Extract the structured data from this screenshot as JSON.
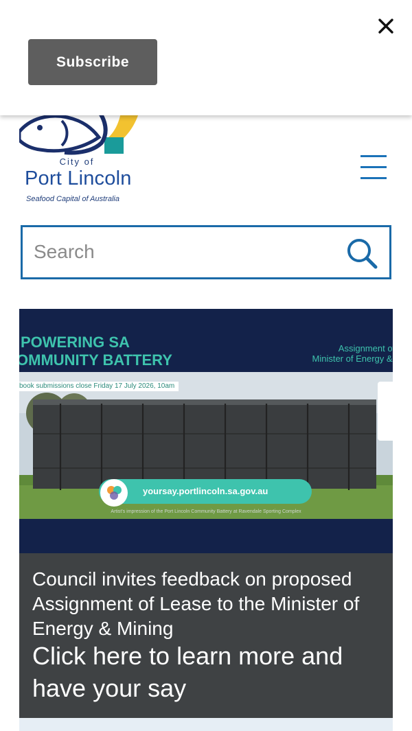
{
  "subscribe_banner": {
    "subscribe_label": "Subscribe",
    "close_icon": "close-icon"
  },
  "header": {
    "logo": {
      "city_of": "City of",
      "name": "Port Lincoln",
      "tagline": "Seafood Capital of Australia"
    },
    "menu_icon": "hamburger-menu-icon"
  },
  "search": {
    "placeholder": "Search",
    "icon": "search-icon"
  },
  "feature": {
    "image": {
      "title_line1": "POWERING SA",
      "title_line2": "OMMUNITY BATTERY",
      "right_line1": "Assignment of L",
      "right_line2": "Minister of Energy & M",
      "deadline": "book submissions close Friday 17 July 2026, 10am",
      "url": "yoursay.portlincoln.sa.gov.au",
      "caption": "Artist's impression of the Port Lincoln Community Battery at Ravendale Sporting Complex"
    },
    "description": "Council invites feedback on proposed Assignment of Lease to the Minister of Energy & Mining",
    "cta": "Click here to learn more and have your say"
  },
  "colors": {
    "subscribe_bg": "#5e5e5e",
    "brand_blue": "#1a6aa8",
    "card_text_bg": "#3f4244",
    "image_navy": "#13224a",
    "image_teal": "#3ec3ad"
  }
}
